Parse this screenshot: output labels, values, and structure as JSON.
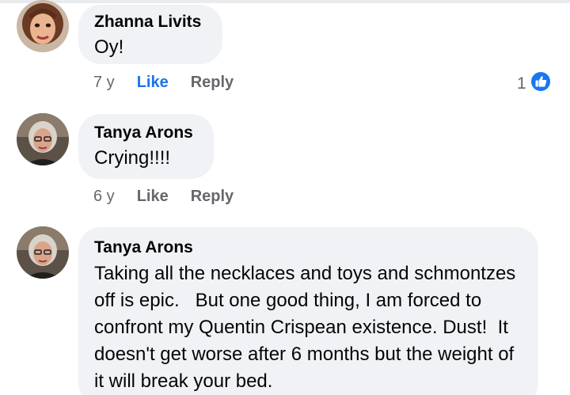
{
  "colors": {
    "bubble": "#f0f2f5",
    "meta_text": "#65676b",
    "liked": "#1b74e4",
    "reaction_blue": "#1877f2"
  },
  "comments": [
    {
      "author": "Zhanna Livits",
      "text": "Oy!",
      "time": "7 y",
      "like_label": "Like",
      "reply_label": "Reply",
      "liked": true,
      "reaction_count": "1",
      "reaction_icon": "thumbs-up-icon"
    },
    {
      "author": "Tanya Arons",
      "text": "Crying!!!!",
      "time": "6 y",
      "like_label": "Like",
      "reply_label": "Reply",
      "liked": false
    },
    {
      "author": "Tanya Arons",
      "text": "Taking all the necklaces and toys and schmontzes off is epic.   But one good thing, I am forced to confront my Quentin Crispean existence. Dust!  It doesn't get worse after 6 months but the weight of it will break your bed."
    }
  ]
}
